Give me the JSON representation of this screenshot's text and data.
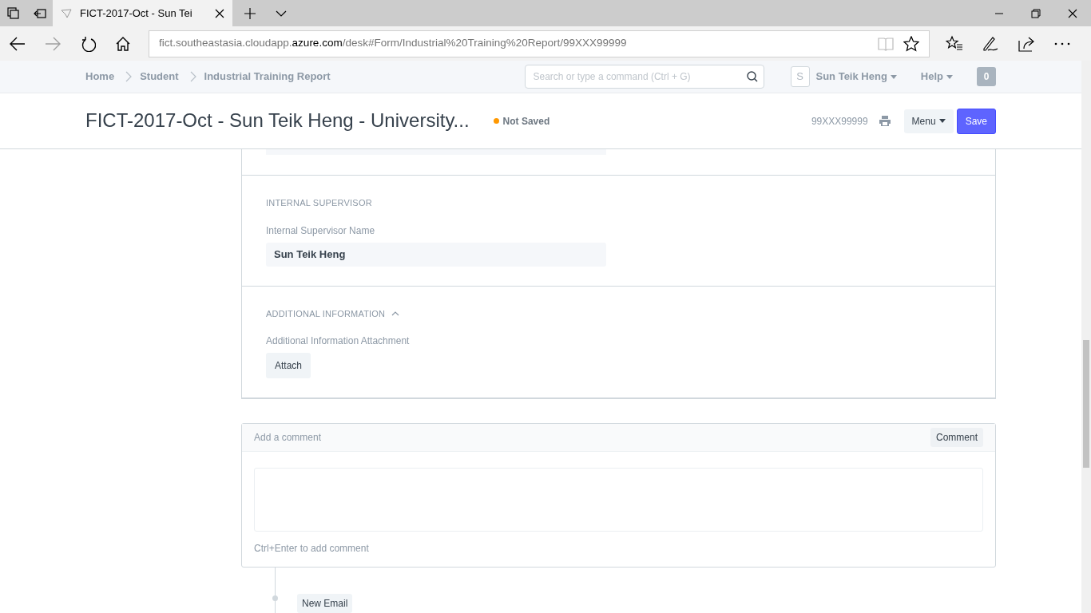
{
  "browser": {
    "tab_title": "FICT-2017-Oct - Sun Tei",
    "url_prefix": "fict.southeastasia.cloudapp.",
    "url_domain": "azure.com",
    "url_path": "/desk#Form/Industrial%20Training%20Report/99XXX99999",
    "forward_disabled": true
  },
  "navbar": {
    "breadcrumbs": [
      "Home",
      "Student",
      "Industrial Training Report"
    ],
    "search": {
      "placeholder": "Search or type a command (Ctrl + G)"
    },
    "user_initial": "S",
    "user_name": "Sun Teik Heng",
    "help": "Help",
    "notifications": "0"
  },
  "header": {
    "title": "FICT-2017-Oct - Sun Teik Heng - University...",
    "status": "Not Saved",
    "doc_name": "99XXX99999",
    "menu": "Menu",
    "save": "Save"
  },
  "sections": [
    {
      "heading": "INTERNAL SUPERVISOR",
      "fields": [
        {
          "kind": "data",
          "label": "Internal Supervisor Name",
          "value": "Sun Teik Heng"
        }
      ]
    },
    {
      "heading": "ADDITIONAL INFORMATION",
      "expanded": true,
      "fields": [
        {
          "kind": "attach",
          "label": "Additional Information Attachment",
          "button": "Attach"
        }
      ]
    }
  ],
  "comment": {
    "placeholder": "Add a comment",
    "button": "Comment",
    "hint": "Ctrl+Enter to add comment"
  },
  "timeline": [
    {
      "label": "New Email"
    }
  ]
}
